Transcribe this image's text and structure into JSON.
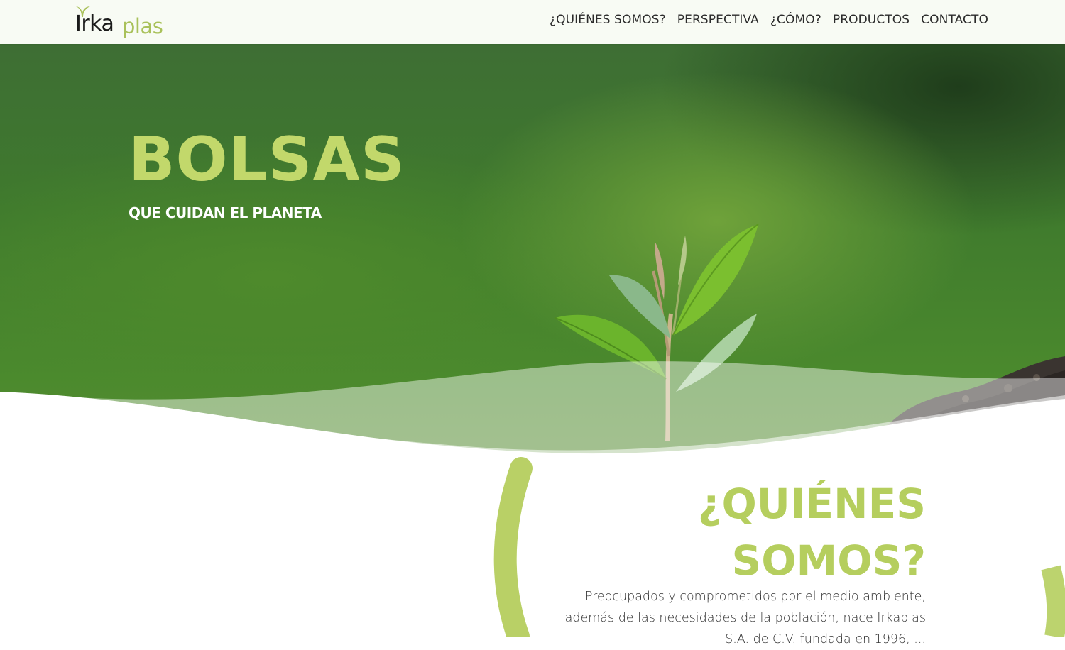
{
  "header": {
    "logo": {
      "irka": "Irka",
      "plas": "plas"
    },
    "nav": [
      "¿QUIÉNES SOMOS?",
      "PERSPECTIVA",
      "¿CÓMO?",
      "PRODUCTOS",
      "CONTACTO"
    ]
  },
  "hero": {
    "title": "BOLSAS",
    "subtitle": "QUE CUIDAN EL PLANETA"
  },
  "about": {
    "title_line1": "¿QUIÉNES",
    "title_line2": "SOMOS?",
    "text": "Preocupados y comprometidos por el medio ambiente, además de las necesidades de la población, nace Irkaplas S.A. de C.V. fundada en 1996, ..."
  },
  "colors": {
    "accent": "#b5ce5e",
    "hero_title": "#c2d86b",
    "header_bg": "#f8fbf4"
  },
  "icons": [
    "sprout-logo-icon",
    "plant-image"
  ]
}
